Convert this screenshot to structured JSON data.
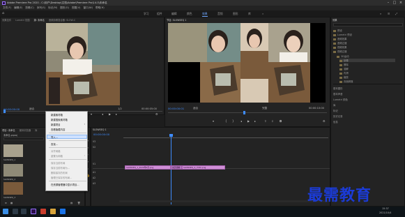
{
  "window": {
    "title": "Adobe Premiere Pro 2020 - C:\\用户\\Desktop\\文档\\Adobe\\Premiere Pro\\14.0\\未命名"
  },
  "menu": [
    "文件(F)",
    "编辑(E)",
    "剪辑(C)",
    "序列(S)",
    "标记(M)",
    "图形(G)",
    "视图(V)",
    "窗口(W)",
    "帮助(H)"
  ],
  "workspaces": [
    {
      "label": "学习",
      "active": false
    },
    {
      "label": "组件",
      "active": false
    },
    {
      "label": "编辑",
      "active": false
    },
    {
      "label": "颜色",
      "active": false
    },
    {
      "label": "效果",
      "active": true
    },
    {
      "label": "音频",
      "active": false
    },
    {
      "label": "图形",
      "active": false
    },
    {
      "label": "库",
      "active": false
    }
  ],
  "source_panel": {
    "tabs": [
      "效果控件",
      "Lumetri 范围",
      "源: 未命名",
      "音频剪辑混合器: SLOW-C"
    ],
    "timecode_left": "00:00:00:00",
    "fit": "适合",
    "ratio": "1/2",
    "timecode_right": "00:00:05:00"
  },
  "program_panel": {
    "tabs": [
      "节目: SLOWSEQ 1"
    ],
    "timecode_left": "00:00:00:01",
    "fit": "适合",
    "ratio": "完整",
    "timecode_right": "00:00:10:00"
  },
  "project_panel": {
    "tabs": [
      "项目: 未命名",
      "媒体浏览器",
      "库"
    ],
    "filename": "未命名.prproj",
    "items": [
      "SLOWSEQ_1",
      "SLOWSEQ_2",
      "SLOWSEQ_3"
    ]
  },
  "timeline": {
    "tab": "SLOWSEQ 1",
    "timecode": "00:00:00:00",
    "tracks": [
      "V3",
      "V2",
      "V1",
      "A1",
      "A2",
      "A3"
    ],
    "clips": [
      {
        "label": "SLOWSEQ_1_2020年6月.png"
      },
      {
        "label": "交叉溶解"
      },
      {
        "label": "SLOWSEQ_2_(720).png"
      }
    ]
  },
  "context_menu": {
    "items": [
      {
        "label": "新建素材箱",
        "enabled": true,
        "submenu": false
      },
      {
        "label": "新建搜索素材箱",
        "enabled": true,
        "submenu": false
      },
      {
        "label": "新建项目",
        "enabled": true,
        "submenu": true
      },
      {
        "label": "查看隐藏内容",
        "enabled": true,
        "submenu": false
      },
      {
        "label": "导入...",
        "enabled": true,
        "submenu": false,
        "highlighted": true
      },
      {
        "label": "查找...",
        "enabled": true,
        "submenu": false
      },
      {
        "label": "对齐网格",
        "enabled": false,
        "submenu": false
      },
      {
        "label": "重置为网格",
        "enabled": false,
        "submenu": true
      },
      {
        "label": "保存当前布局",
        "enabled": false,
        "submenu": false
      },
      {
        "label": "保存当前布局为...",
        "enabled": false,
        "submenu": false
      },
      {
        "label": "删除保存的布局",
        "enabled": false,
        "submenu": false
      },
      {
        "label": "管理已保存的布局...",
        "enabled": false,
        "submenu": false
      },
      {
        "label": "在资源管理器中显示项目...",
        "enabled": true,
        "submenu": false
      }
    ]
  },
  "effects_panel": {
    "tabs": [
      "效果",
      "音频剪辑混合器"
    ],
    "items": [
      "预设",
      "Lumetri 预设",
      "音频效果",
      "音频过渡",
      "视频效果",
      "视频过渡",
      "3D运动",
      "划像",
      "擦除",
      "溶解",
      "内滑",
      "缩放",
      "页面剥落"
    ],
    "bottom": [
      "基本图形",
      "基本声音",
      "Lumetri 颜色",
      "库",
      "标记",
      "历史记录",
      "信息"
    ]
  },
  "taskbar": {
    "time": "15:37",
    "date": "2021/10/4"
  },
  "watermark": "最需教育",
  "colors": {
    "accent": "#3f8cff",
    "clip": "#cf8ed6",
    "watermark": "#1b3bd6"
  }
}
